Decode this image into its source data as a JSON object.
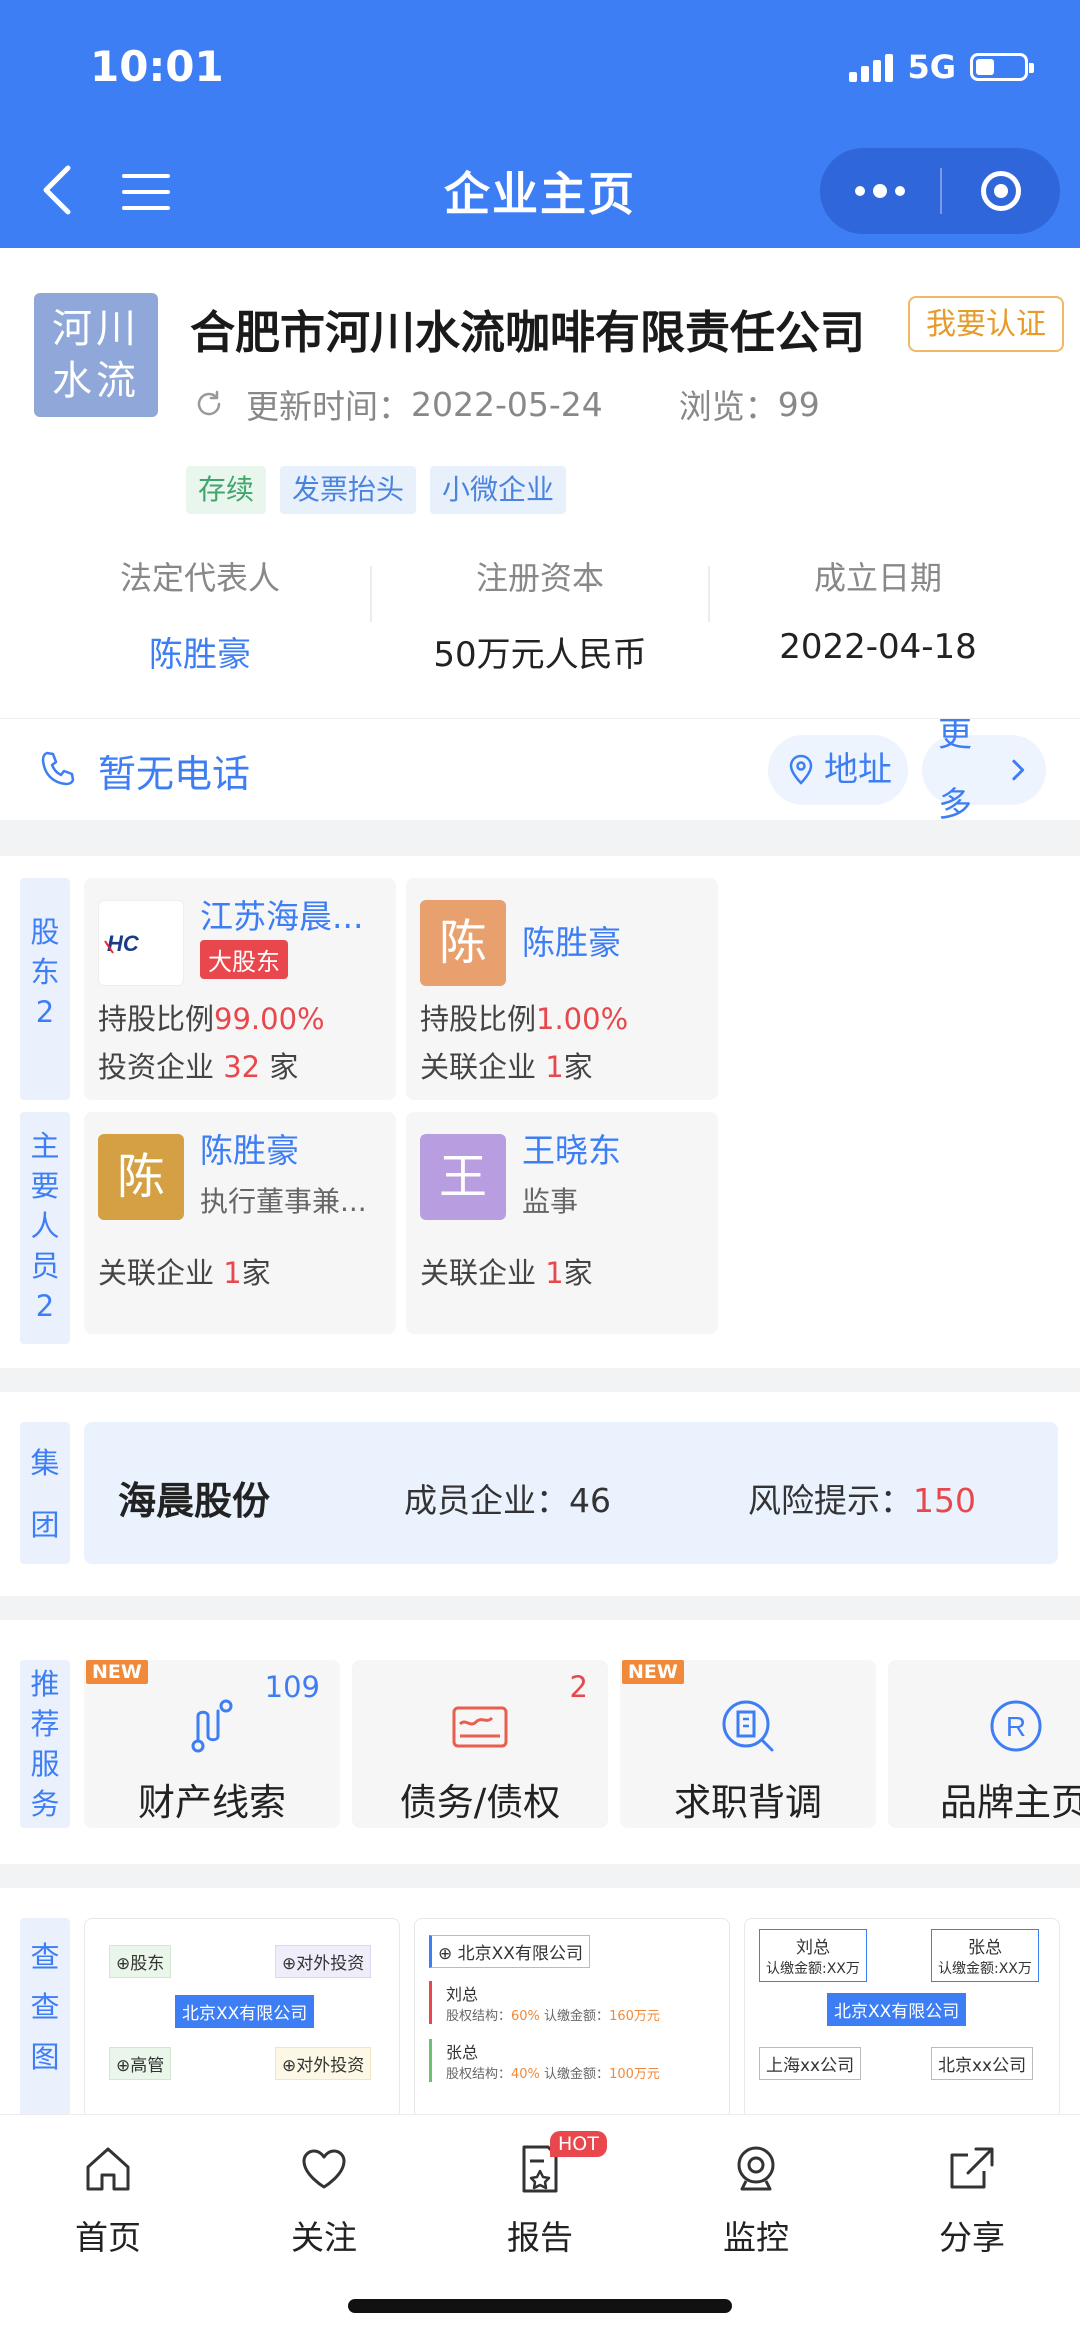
{
  "status_bar": {
    "time": "10:01",
    "network": "5G"
  },
  "nav": {
    "title": "企业主页"
  },
  "company": {
    "logo_text": "河川水流",
    "name": "合肥市河川水流咖啡有限责任公司",
    "certify_label": "我要认证",
    "update_label": "更新时间：",
    "update_date": "2022-05-24",
    "views_label": "浏览：",
    "views": "99",
    "tags": [
      "存续",
      "发票抬头",
      "小微企业"
    ],
    "info": [
      {
        "key": "法定代表人",
        "value": "陈胜豪"
      },
      {
        "key": "注册资本",
        "value": "50万元人民币"
      },
      {
        "key": "成立日期",
        "value": "2022-04-18"
      }
    ],
    "phone_text": "暂无电话",
    "address_label": "地址",
    "more_label": "更多"
  },
  "shareholders": {
    "label_chars": [
      "股",
      "东",
      "2"
    ],
    "items": [
      {
        "name": "江苏海晨...",
        "logo_text": "HC",
        "badge": "大股东",
        "ratio_label": "持股比例",
        "ratio": "99.00%",
        "invest_prefix": "投资企业 ",
        "invest_count": "32",
        "invest_suffix": " 家"
      },
      {
        "name": "陈胜豪",
        "avatar": "陈",
        "avatar_color": "#e8a06e",
        "ratio_label": "持股比例",
        "ratio": "1.00%",
        "related_prefix": "关联企业 ",
        "related_count": "1",
        "related_suffix": "家"
      }
    ]
  },
  "staff": {
    "label_chars": [
      "主",
      "要",
      "人",
      "员",
      "2"
    ],
    "items": [
      {
        "name": "陈胜豪",
        "avatar": "陈",
        "avatar_color": "#d4a043",
        "role": "执行董事兼...",
        "related_prefix": "关联企业 ",
        "related_count": "1",
        "related_suffix": "家"
      },
      {
        "name": "王晓东",
        "avatar": "王",
        "avatar_color": "#b89ee0",
        "role": "监事",
        "related_prefix": "关联企业 ",
        "related_count": "1",
        "related_suffix": "家"
      }
    ]
  },
  "group": {
    "label_chars": [
      "集",
      "团"
    ],
    "name": "海晨股份",
    "members_label": "成员企业：",
    "members": "46",
    "risk_label": "风险提示：",
    "risk": "150"
  },
  "services": {
    "label_chars": [
      "推",
      "荐",
      "服",
      "务"
    ],
    "items": [
      {
        "label": "财产线索",
        "new": "NEW",
        "count": "109",
        "count_color": "#3e7ef5",
        "icon": "route-icon"
      },
      {
        "label": "债务/债权",
        "new": "",
        "count": "2",
        "count_color": "#e8484d",
        "icon": "debt-card-icon"
      },
      {
        "label": "求职背调",
        "new": "NEW",
        "count": "",
        "icon": "building-search-icon"
      },
      {
        "label": "品牌主页",
        "new": "",
        "count": "",
        "icon": "trademark-icon"
      }
    ]
  },
  "check_chart": {
    "label_chars": [
      "查",
      "查",
      "图"
    ],
    "thumb1": {
      "center": "北京XX有限公司",
      "shareholder": "股东",
      "invest1": "对外投资",
      "exec": "高管",
      "invest2": "对外投资"
    },
    "thumb2": {
      "company": "北京XX有限公司",
      "p1": "刘总",
      "p1_detail_a": "股权结构：",
      "p1_pct": "60%",
      "p1_detail_b": " 认缴金额：",
      "p1_amt": "160万元",
      "p2": "张总",
      "p2_detail_a": "股权结构：",
      "p2_pct": "40%",
      "p2_detail_b": " 认缴金额：",
      "p2_amt": "100万元"
    },
    "thumb3": {
      "p1": "刘总",
      "p1_sub": "认缴金额:XX万",
      "p2": "张总",
      "p2_sub": "认缴金额:XX万",
      "center": "北京XX有限公司",
      "sub1": "上海xx公司",
      "sub2": "北京xx公司"
    }
  },
  "tabbar": {
    "items": [
      {
        "label": "首页",
        "icon": "home-icon"
      },
      {
        "label": "关注",
        "icon": "heart-icon"
      },
      {
        "label": "报告",
        "icon": "report-icon",
        "badge": "HOT"
      },
      {
        "label": "监控",
        "icon": "camera-icon"
      },
      {
        "label": "分享",
        "icon": "share-icon"
      }
    ]
  },
  "colors": {
    "primary": "#3e7ef5",
    "danger": "#e8484d",
    "certify": "#e69b2a"
  }
}
